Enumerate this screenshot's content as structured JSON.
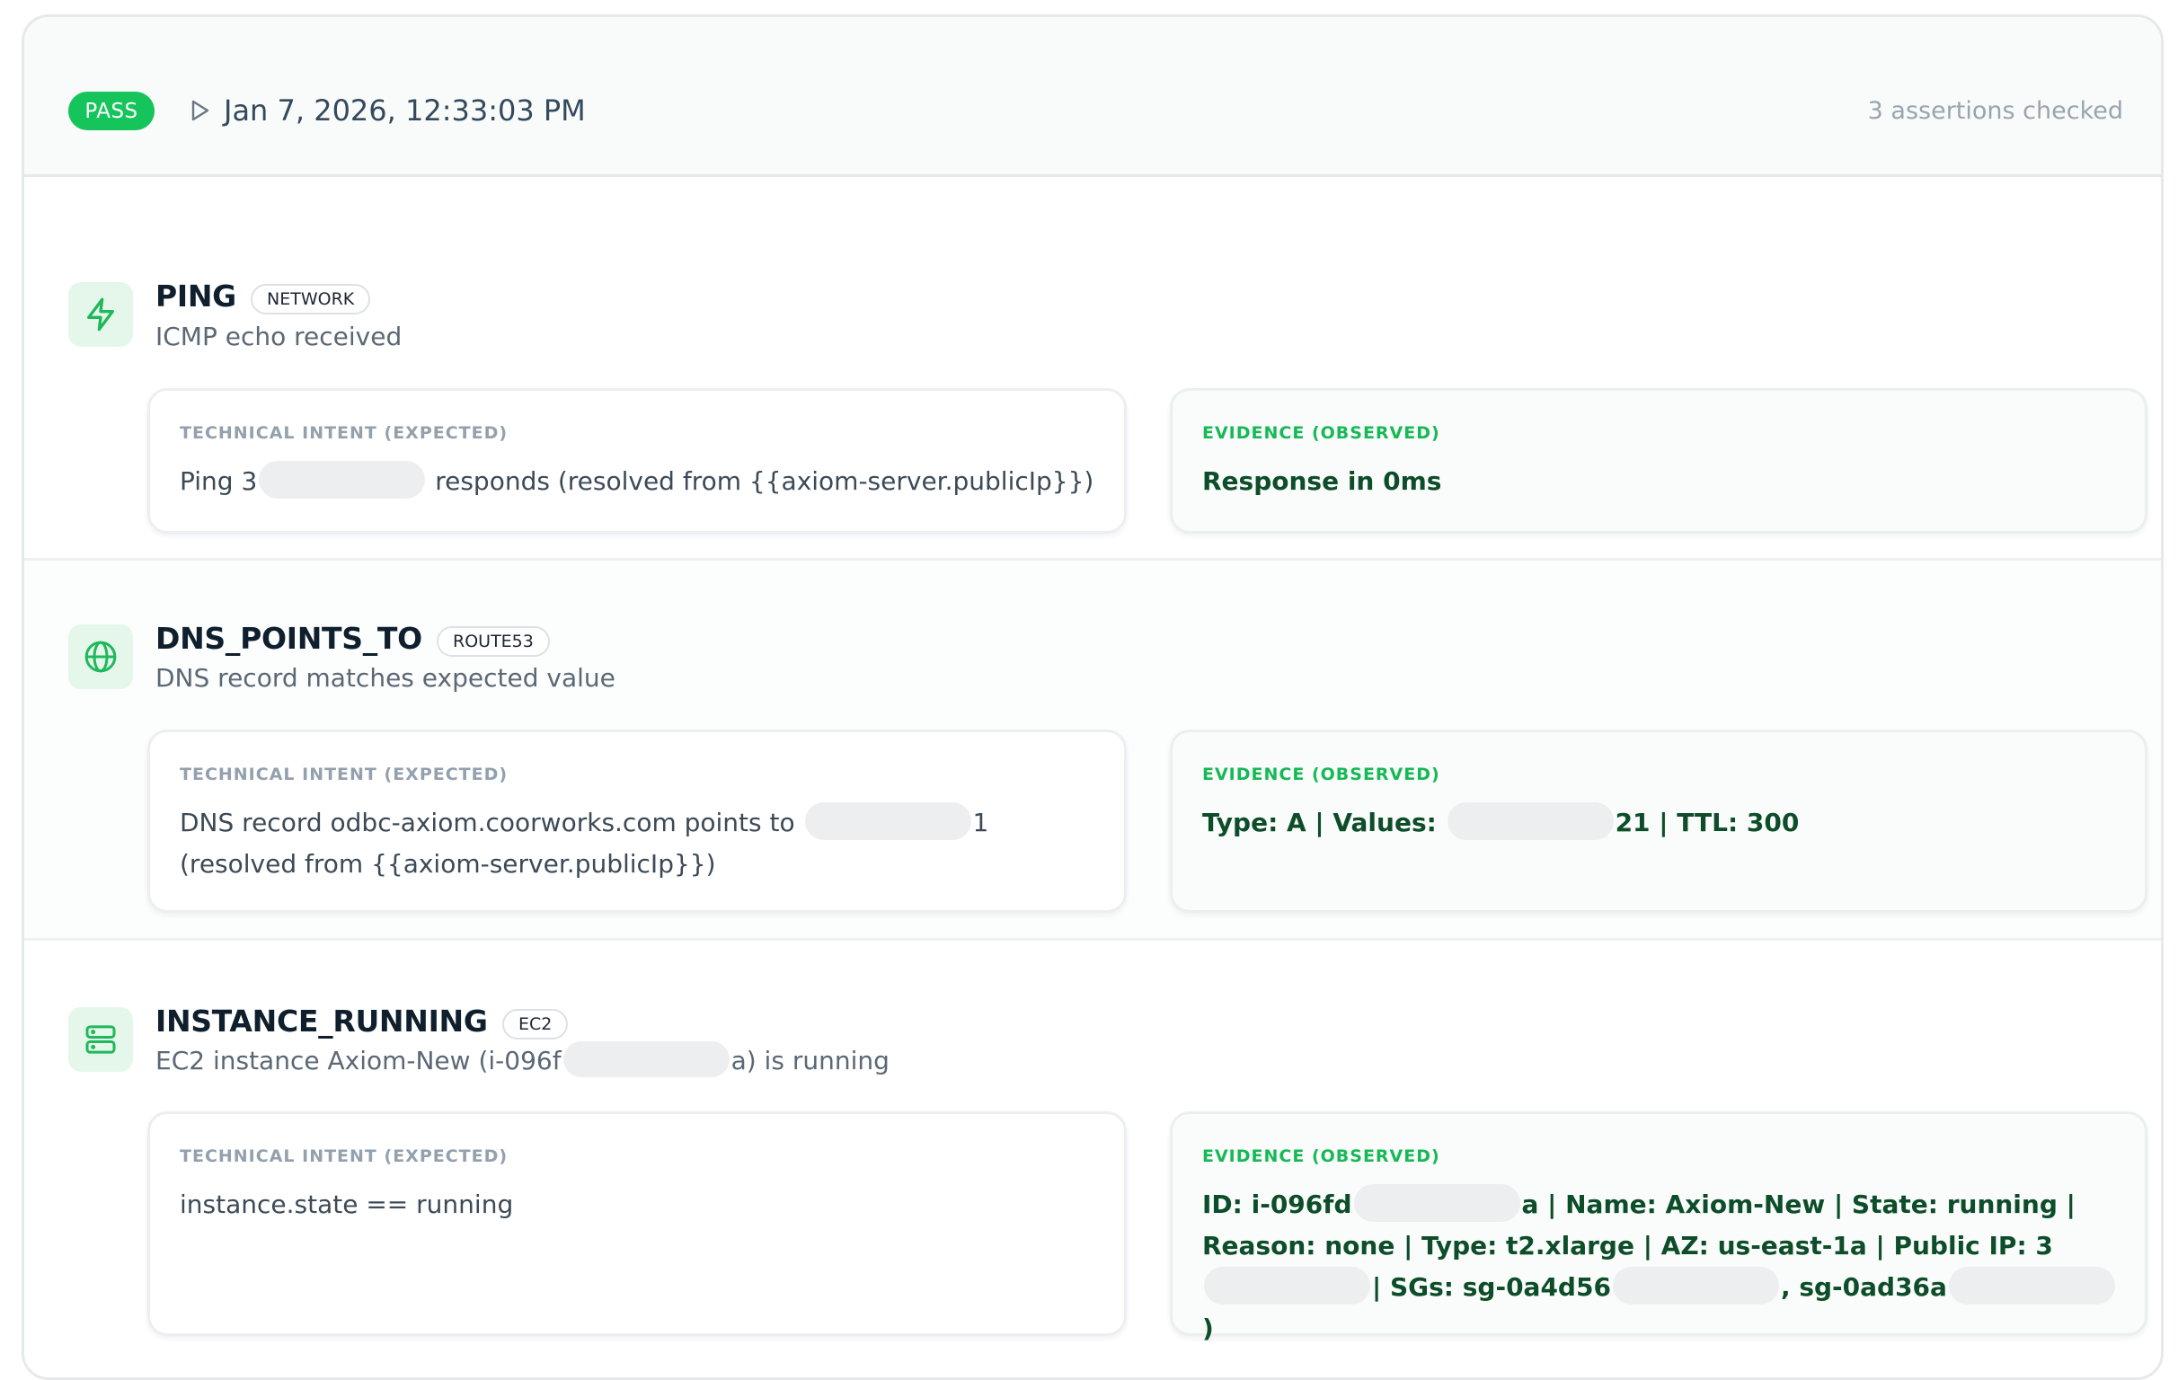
{
  "header": {
    "status": "PASS",
    "timestamp": "Jan 7, 2026, 12:33:03 PM",
    "assertions_text": "3 assertions checked"
  },
  "colors": {
    "pass_green": "#16c45c",
    "evidence_label": "#16b956",
    "evidence_text": "#0d4d2a",
    "icon_tile_bg": "#e4f7ea"
  },
  "assertions": [
    {
      "icon": "lightning-icon",
      "title": "PING",
      "tag": "NETWORK",
      "subtitle": "ICMP echo received",
      "intent_label": "TECHNICAL INTENT (EXPECTED)",
      "intent_pre": "Ping 3",
      "intent_post": "responds (resolved from {{axiom-server.publicIp}})",
      "evidence_label": "EVIDENCE (OBSERVED)",
      "evidence": "Response in 0ms"
    },
    {
      "icon": "globe-icon",
      "title": "DNS_POINTS_TO",
      "tag": "ROUTE53",
      "subtitle": "DNS record matches expected value",
      "intent_label": "TECHNICAL INTENT (EXPECTED)",
      "intent_pre": "DNS record odbc-axiom.coorworks.com points to",
      "intent_post": "1 (resolved from {{axiom-server.publicIp}})",
      "evidence_label": "EVIDENCE (OBSERVED)",
      "evidence_pre": "Type: A | Values:",
      "evidence_post": "21 | TTL: 300"
    },
    {
      "icon": "server-icon",
      "title": "INSTANCE_RUNNING",
      "tag": "EC2",
      "subtitle_pre": "EC2 instance Axiom-New (i-096f",
      "subtitle_post": "a) is running",
      "intent_label": "TECHNICAL INTENT (EXPECTED)",
      "intent": "instance.state == running",
      "evidence_label": "EVIDENCE (OBSERVED)",
      "evidence_p1": "ID: i-096fd",
      "evidence_p2": "a | Name: Axiom-New | State: running | Reason: none | Type: t2.xlarge | AZ: us-east-1a | Public IP: 3",
      "evidence_p3": "| SGs: sg-0a4d56",
      "evidence_p4": ", sg-0ad36a",
      "evidence_p5": ")"
    }
  ]
}
